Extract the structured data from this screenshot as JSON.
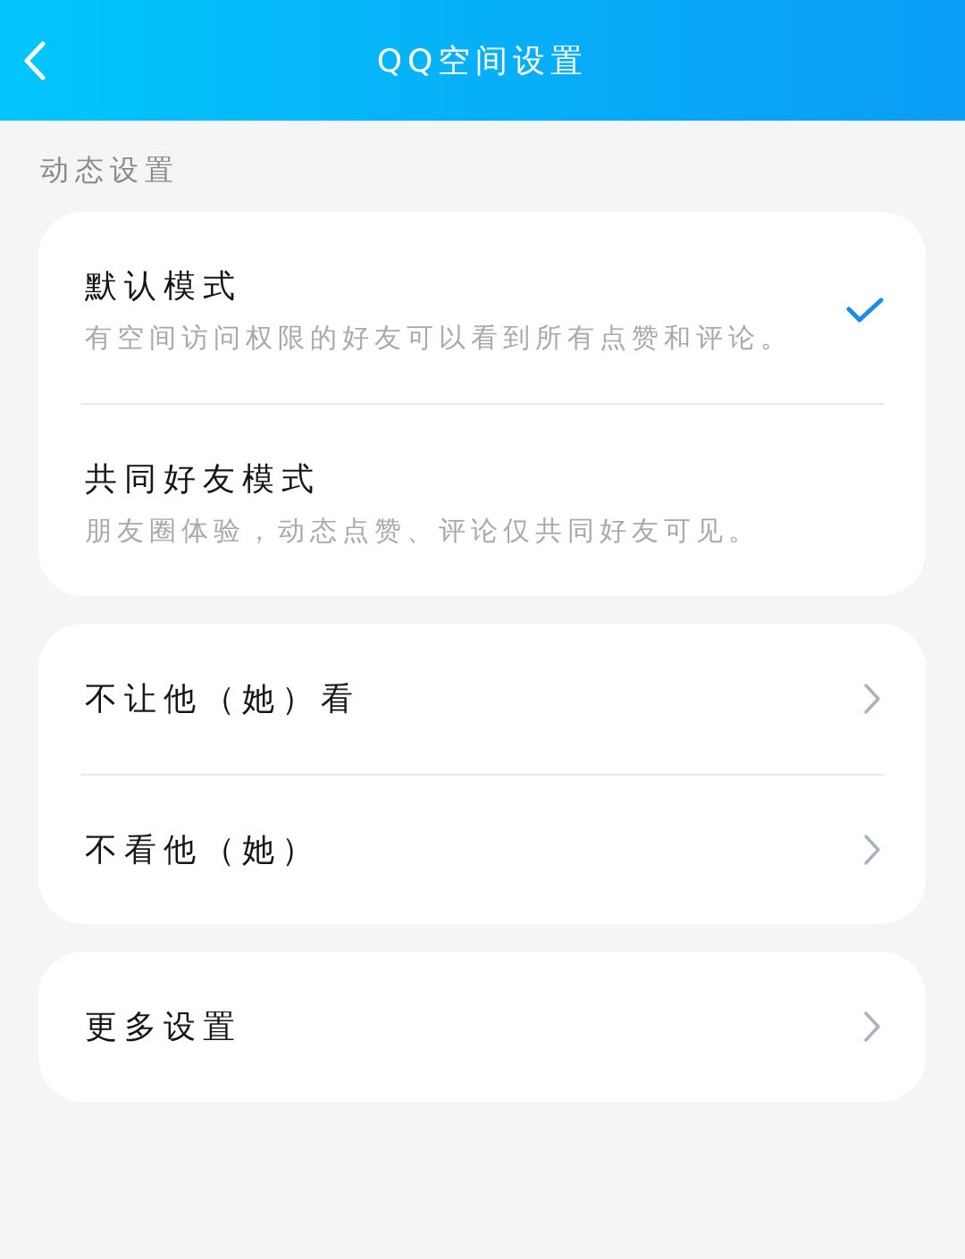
{
  "top_bar": {
    "title": "QQ空间设置"
  },
  "section_label": "动态设置",
  "groups": [
    {
      "kind": "options",
      "items": [
        {
          "title": "默认模式",
          "description": "有空间访问权限的好友可以看到所有点赞和评论。",
          "selected": true
        },
        {
          "title": "共同好友模式",
          "description": "朋友圈体验，动态点赞、评论仅共同好友可见。",
          "selected": false
        }
      ]
    },
    {
      "kind": "links",
      "items": [
        {
          "title": "不让他（她）看"
        },
        {
          "title": "不看他（她）"
        }
      ]
    },
    {
      "kind": "links",
      "items": [
        {
          "title": "更多设置"
        }
      ]
    }
  ]
}
